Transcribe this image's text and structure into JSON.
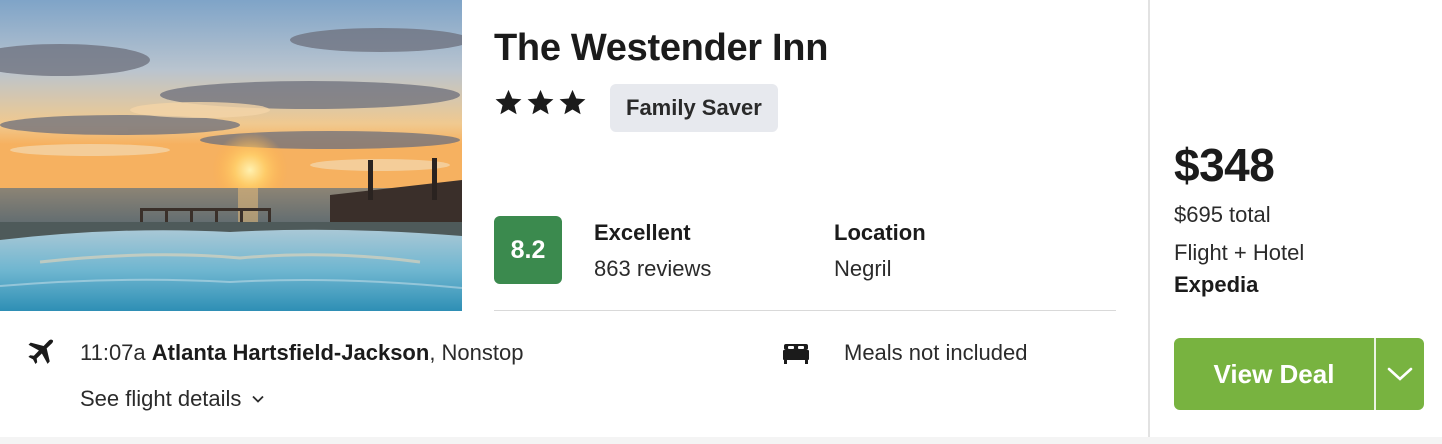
{
  "hotel": {
    "name": "The Westender Inn",
    "star_rating": 3,
    "badge": "Family Saver",
    "score": "8.2",
    "rating_label": "Excellent",
    "review_count": "863 reviews",
    "location_label": "Location",
    "location_value": "Negril"
  },
  "flight": {
    "time": "11:07a",
    "airport": "Atlanta Hartsfield-Jackson",
    "stops": ", Nonstop",
    "details_link": "See flight details"
  },
  "amenities": {
    "meals": "Meals not included"
  },
  "pricing": {
    "price": "$348",
    "total": "$695 total",
    "package": "Flight + Hotel",
    "provider": "Expedia",
    "cta": "View Deal"
  },
  "colors": {
    "score_bg": "#3b8a4e",
    "cta_bg": "#78b340",
    "badge_bg": "#e7e9ee"
  },
  "icons": [
    "plane-icon",
    "bed-icon",
    "chevron-down-icon",
    "star-icon"
  ]
}
